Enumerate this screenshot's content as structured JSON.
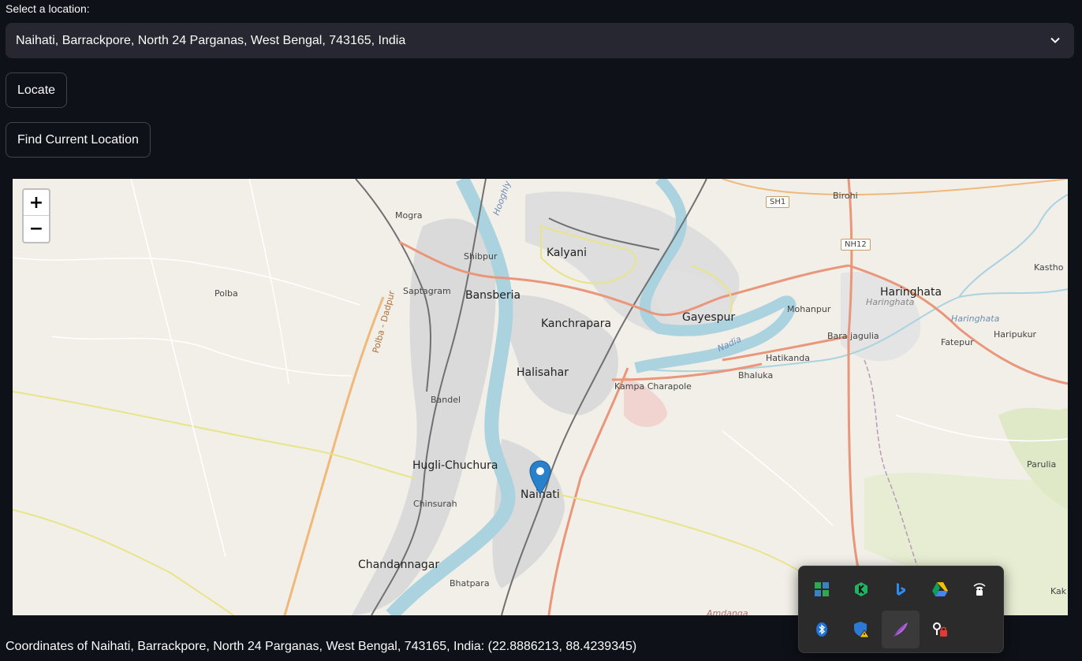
{
  "select": {
    "label": "Select a location:",
    "value": "Naihati, Barrackpore, North 24 Parganas, West Bengal, 743165, India"
  },
  "buttons": {
    "locate": "Locate",
    "find_current": "Find Current Location"
  },
  "map": {
    "zoom_in": "+",
    "zoom_out": "−",
    "labels": {
      "mogra": "Mogra",
      "hooghly": "Hooghly",
      "kalyani": "Kalyani",
      "birohi": "Birohi",
      "shibpur": "Shibpur",
      "polba": "Polba",
      "saptagram": "Saptagram",
      "bansberia": "Bansberia",
      "polba_dadpur": "Polba - Dadpur",
      "kanchrapara": "Kanchrapara",
      "gayespur": "Gayespur",
      "mohanpur": "Mohanpur",
      "haringhata": "Haringhata",
      "haringhata_small": "Haringhata",
      "haringhata_water": "Haringhata",
      "kastho": "Kastho",
      "bara_jagulia": "Bara jagulia",
      "fatepur": "Fatepur",
      "haripukur": "Haripukur",
      "nadia": "Nadia",
      "hatikanda": "Hatikanda",
      "halisahar": "Halisahar",
      "bhaluka": "Bhaluka",
      "kampa_charapole": "Kampa Charapole",
      "bandel": "Bandel",
      "hugli_chuchura": "Hugli-Chuchura",
      "naihati": "Naihati",
      "chinsurah": "Chinsurah",
      "parulia": "Parulia",
      "chandannagar": "Chandannagar",
      "bhatpara": "Bhatpara",
      "amdanga": "Amdanga",
      "kak": "Kak"
    },
    "shields": {
      "sh1": "SH1",
      "nh12": "NH12"
    },
    "colors": {
      "land": "#f2efe9",
      "river": "#aad3df",
      "urban": "#d9d9d9",
      "primary_road": "#f7b38a",
      "secondary_road": "#f7f4a6",
      "rail": "#777777",
      "marker": "#2a81cb"
    }
  },
  "coordinates_text": "Coordinates of Naihati, Barrackpore, North 24 Parganas, West Bengal, 743165, India: (22.8886213, 88.4239345)",
  "tray": {
    "icons": [
      "widgets-icon",
      "kaspersky-icon",
      "bing-icon",
      "google-drive-icon",
      "vpn-lock-icon",
      "bluetooth-icon",
      "defender-warning-icon",
      "feather-icon",
      "security-lock-icon"
    ]
  }
}
